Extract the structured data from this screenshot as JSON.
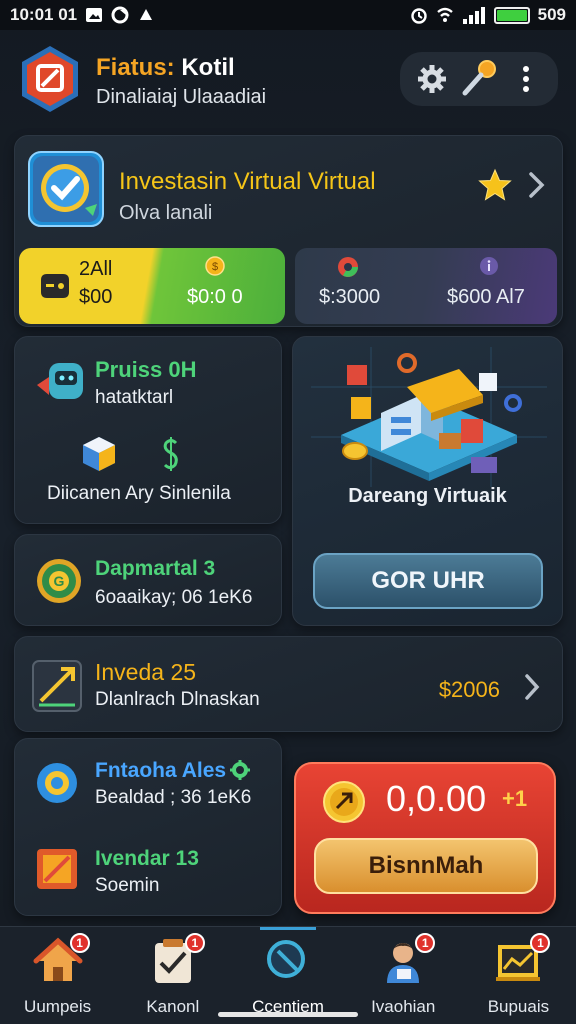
{
  "status_bar": {
    "time": "10:01 01",
    "battery_label": "509"
  },
  "header": {
    "title_prefix": "Fiatus: ",
    "title_name": "Kotil",
    "subtitle": "Dinaliaiaj Ulaaadiai"
  },
  "hero": {
    "title": "Investasin Virtual Virtual",
    "subtitle": "Olva lanali",
    "stat_left": {
      "line1": "2All",
      "line2": "$00",
      "value": "$0:0 0"
    },
    "stat_right": {
      "value_left": "$:3000",
      "value_right": "$600 Al7"
    }
  },
  "card_prius": {
    "title": "Pruiss 0H",
    "subtitle": "hatatktarl",
    "footer": "Diicanen Ary Sinlenila"
  },
  "card_daparnatal": {
    "title": "Dapmartal 3",
    "subtitle": "6oaaikay; 06 1eK6"
  },
  "card_dareang": {
    "caption": "Dareang Virtuaik",
    "button": "GOR UHR"
  },
  "card_invest": {
    "title": "Inveda 25",
    "subtitle": "Dlanlrach Dlnaskan",
    "value": "$2006"
  },
  "card_settings": {
    "item1_title": "Fntaoha Ales",
    "item1_sub": "Bealdad ; 36 1eK6",
    "item2_title": "Ivendar 13",
    "item2_sub": "Soemin"
  },
  "reward": {
    "amount": "0,0.00",
    "plus": "+1",
    "button": "BisnnMah"
  },
  "bottom_nav": [
    {
      "label": "Uumpeis",
      "badge": "1",
      "icon": "home-icon"
    },
    {
      "label": "Kanonl",
      "badge": "1",
      "icon": "tasks-icon"
    },
    {
      "label": "Ccentiem",
      "badge": "",
      "icon": "search-icon"
    },
    {
      "label": "Ivaohian",
      "badge": "1",
      "icon": "person-icon"
    },
    {
      "label": "Bupuais",
      "badge": "1",
      "icon": "chart-icon"
    }
  ],
  "colors": {
    "accent_yellow": "#f5b41a",
    "accent_green": "#4ed37a",
    "accent_blue": "#49a6ff",
    "reward_red": "#d13a2c"
  }
}
